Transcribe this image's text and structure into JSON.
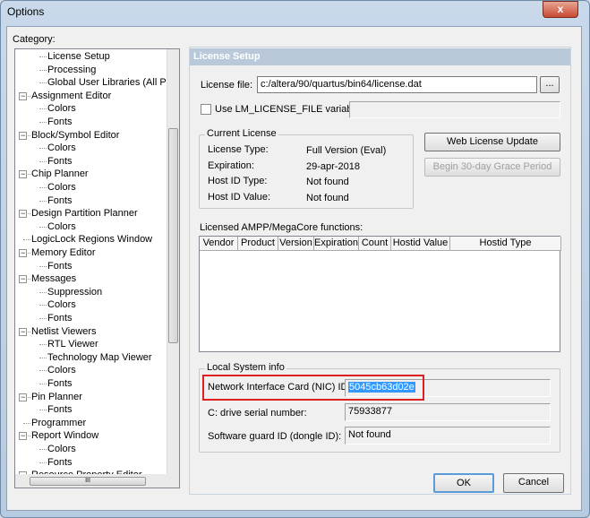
{
  "window": {
    "title": "Options",
    "close_label": "x"
  },
  "category_label": "Category:",
  "tree": [
    {
      "label": "License Setup",
      "level": 1
    },
    {
      "label": "Processing",
      "level": 1
    },
    {
      "label": "Global User Libraries (All Projects)",
      "level": 1
    },
    {
      "label": "Assignment Editor",
      "level": 0,
      "expanded": true
    },
    {
      "label": "Colors",
      "level": 1
    },
    {
      "label": "Fonts",
      "level": 1
    },
    {
      "label": "Block/Symbol Editor",
      "level": 0,
      "expanded": true
    },
    {
      "label": "Colors",
      "level": 1
    },
    {
      "label": "Fonts",
      "level": 1
    },
    {
      "label": "Chip Planner",
      "level": 0,
      "expanded": true
    },
    {
      "label": "Colors",
      "level": 1
    },
    {
      "label": "Fonts",
      "level": 1
    },
    {
      "label": "Design Partition Planner",
      "level": 0,
      "expanded": true
    },
    {
      "label": "Colors",
      "level": 1
    },
    {
      "label": "LogicLock Regions Window",
      "level": 0
    },
    {
      "label": "Memory Editor",
      "level": 0,
      "expanded": true
    },
    {
      "label": "Fonts",
      "level": 1
    },
    {
      "label": "Messages",
      "level": 0,
      "expanded": true
    },
    {
      "label": "Suppression",
      "level": 1
    },
    {
      "label": "Colors",
      "level": 1
    },
    {
      "label": "Fonts",
      "level": 1
    },
    {
      "label": "Netlist Viewers",
      "level": 0,
      "expanded": true
    },
    {
      "label": "RTL Viewer",
      "level": 1
    },
    {
      "label": "Technology Map Viewer",
      "level": 1
    },
    {
      "label": "Colors",
      "level": 1
    },
    {
      "label": "Fonts",
      "level": 1
    },
    {
      "label": "Pin Planner",
      "level": 0,
      "expanded": true
    },
    {
      "label": "Fonts",
      "level": 1
    },
    {
      "label": "Programmer",
      "level": 0
    },
    {
      "label": "Report Window",
      "level": 0,
      "expanded": true
    },
    {
      "label": "Colors",
      "level": 1
    },
    {
      "label": "Fonts",
      "level": 1
    },
    {
      "label": "Resource Property Editor",
      "level": 0,
      "expanded": true
    }
  ],
  "hscroll_grip": "III",
  "panel": {
    "header": "License Setup",
    "license_file_label": "License file:",
    "license_file_value": "c:/altera/90/quartus/bin64/license.dat",
    "browse_label": "...",
    "lm_checkbox_label": "Use LM_LICENSE_FILE variable:",
    "lm_checked": false,
    "lm_value": "",
    "current_license": {
      "title": "Current License",
      "rows": [
        {
          "label": "License Type:",
          "value": "Full Version (Eval)"
        },
        {
          "label": "Expiration:",
          "value": "29-apr-2018"
        },
        {
          "label": "Host ID Type:",
          "value": "Not found"
        },
        {
          "label": "Host ID Value:",
          "value": "Not found"
        }
      ]
    },
    "web_update_label": "Web License Update",
    "grace_label": "Begin 30-day Grace Period",
    "functions_label": "Licensed AMPP/MegaCore functions:",
    "columns": [
      "Vendor",
      "Product",
      "Version",
      "Expiration",
      "Count",
      "Hostid Value",
      "Hostid Type"
    ],
    "local": {
      "title": "Local System info",
      "nic_label": "Network Interface Card (NIC) ID:",
      "nic_value": "5045cb63d02e",
      "serial_label": "C: drive serial number:",
      "serial_value": "75933877",
      "third_label": "Software guard ID (dongle ID):",
      "third_value": "Not found"
    },
    "highlight_color": "#e02020"
  },
  "ok_label": "OK",
  "cancel_label": "Cancel"
}
